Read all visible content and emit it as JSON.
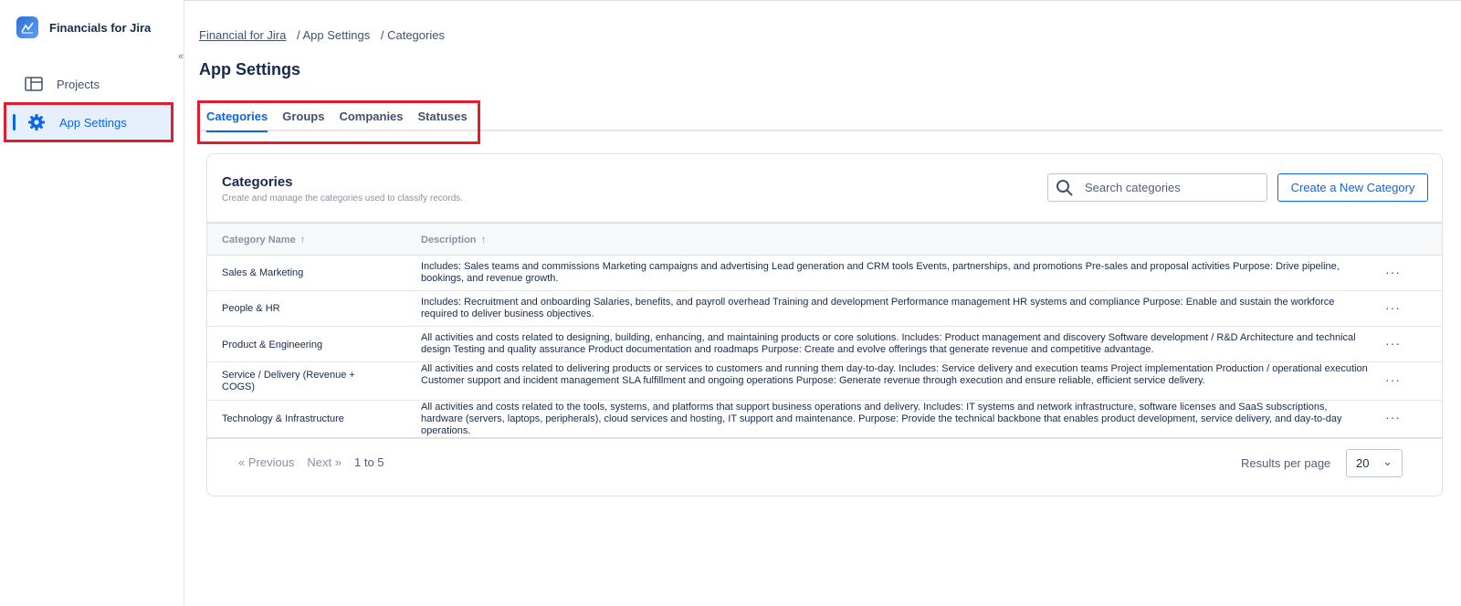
{
  "app": {
    "title": "Financials for Jira",
    "collapse_glyph": "«"
  },
  "sidebar": {
    "items": [
      {
        "label": "Projects",
        "icon": "board-icon"
      },
      {
        "label": "App Settings",
        "icon": "gear-icon",
        "active": true
      }
    ]
  },
  "breadcrumb": {
    "root": "Financial for Jira",
    "second": "/ App Settings",
    "third": "/ Categories"
  },
  "page": {
    "title": "App Settings"
  },
  "tabs": [
    {
      "label": "Categories",
      "active": true
    },
    {
      "label": "Groups"
    },
    {
      "label": "Companies"
    },
    {
      "label": "Statuses"
    }
  ],
  "card": {
    "title": "Categories",
    "subtitle": "Create and manage the categories used to classify records.",
    "search_placeholder": "Search categories",
    "create_label": "Create a New Category"
  },
  "table": {
    "headers": {
      "name": "Category Name",
      "description": "Description",
      "sort_glyph": "↑"
    },
    "rows": [
      {
        "name": "Sales & Marketing",
        "description": "Includes: Sales teams and commissions Marketing campaigns and advertising Lead generation and CRM tools Events, partnerships, and promotions Pre-sales and proposal activities Purpose: Drive pipeline, bookings, and revenue growth."
      },
      {
        "name": "People & HR",
        "description": "Includes: Recruitment and onboarding Salaries, benefits, and payroll overhead Training and development Performance management HR systems and compliance Purpose: Enable and sustain the workforce required to deliver business objectives."
      },
      {
        "name": "Product & Engineering",
        "description": "All activities and costs related to designing, building, enhancing, and maintaining products or core solutions. Includes: Product management and discovery Software development / R&D Architecture and technical design Testing and quality assurance Product documentation and roadmaps Purpose: Create and evolve offerings that generate revenue and competitive advantage."
      },
      {
        "name": "Service / Delivery (Revenue + COGS)",
        "description": "All activities and costs related to delivering products or services to customers and running them day-to-day. Includes: Service delivery and execution teams Project implementation Production / operational execution Customer support and incident management SLA fulfillment and ongoing operations Purpose: Generate revenue through execution and ensure reliable, efficient service delivery."
      },
      {
        "name": "Technology & Infrastructure",
        "description": "All activities and costs related to the tools, systems, and platforms that support business operations and delivery. Includes: IT systems and network infrastructure, software licenses and SaaS subscriptions, hardware (servers, laptops, peripherals), cloud services and hosting, IT support and maintenance. Purpose: Provide the technical backbone that enables product development, service delivery, and day-to-day operations."
      }
    ],
    "row_menu_glyph": "···"
  },
  "pagination": {
    "previous": "«  Previous",
    "next": "Next  »",
    "range": "1 to 5",
    "results_label": "Results per page",
    "per_page": "20",
    "dropdown_glyph": "⌄"
  },
  "colors": {
    "accent": "#0c66e4",
    "highlight": "#e01e2d",
    "active_bg": "#e6effc"
  }
}
